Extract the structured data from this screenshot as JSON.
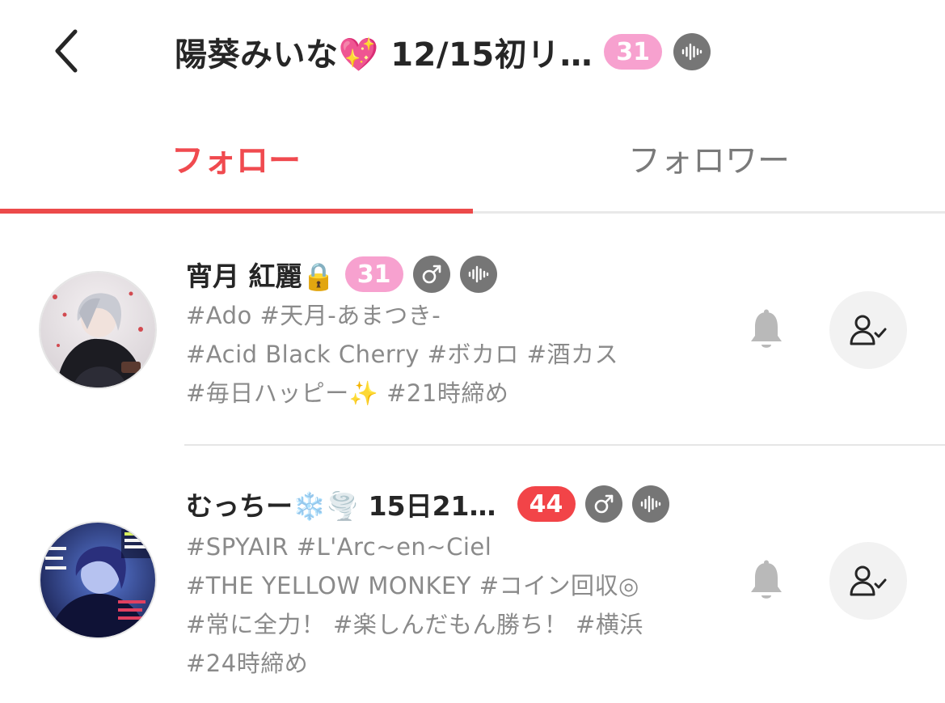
{
  "header": {
    "title": "陽葵みいな💖 12/15初リ…",
    "level": "31",
    "level_color": "#f7a1cf",
    "icons": [
      "back-arrow-icon",
      "voice-wave-icon"
    ]
  },
  "tabs": [
    {
      "label": "フォロー",
      "active": true,
      "color": "#f04a4f"
    },
    {
      "label": "フォロワー",
      "active": false,
      "color": "#7a7a7a"
    }
  ],
  "users": [
    {
      "name": "宵月 紅麗🔒",
      "level": "31",
      "level_color": "#f7a1cf",
      "gender_icon": "male-icon",
      "voice_icon": "voice-wave-icon",
      "tags": [
        "#Ado #天月-あまつき-",
        "#Acid Black Cherry #ボカロ #酒カス",
        "#毎日ハッピー✨ #21時締め"
      ]
    },
    {
      "name": "むっちー❄️🌪️ 15日21…",
      "level": "44",
      "level_color": "#f24448",
      "gender_icon": "male-icon",
      "voice_icon": "voice-wave-icon",
      "tags": [
        "#SPYAIR #L'Arc~en~Ciel",
        "#THE YELLOW MONKEY #コイン回収◎",
        "#常に全力！ #楽しんだもん勝ち！ #横浜",
        "#24時締め"
      ]
    }
  ]
}
